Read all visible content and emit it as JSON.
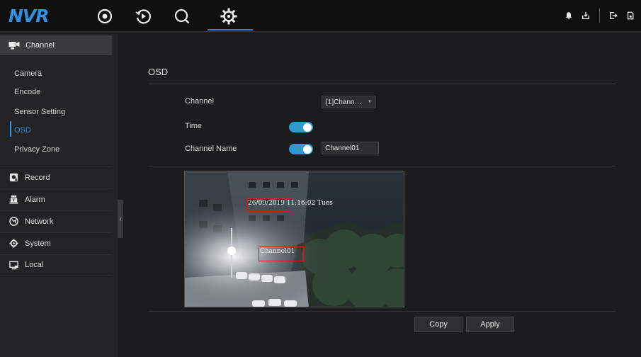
{
  "app": {
    "logo": "NVR"
  },
  "topnav": {
    "icons": [
      "live-view-icon",
      "playback-icon",
      "search-icon",
      "settings-icon"
    ],
    "active": "settings-icon",
    "accent": "#2f8fe0"
  },
  "topright": {
    "icons": [
      "alarm-bell-icon",
      "download-icon",
      "logout-icon",
      "lock-screen-icon"
    ]
  },
  "sidebar": {
    "section": "Channel",
    "subitems": [
      "Camera",
      "Encode",
      "Sensor Setting",
      "OSD",
      "Privacy Zone"
    ],
    "active_subitem": "OSD",
    "menu": [
      "Record",
      "Alarm",
      "Network",
      "System",
      "Local"
    ]
  },
  "main": {
    "title": "OSD",
    "channel_label": "Channel",
    "channel_value": "[1]Chann…",
    "time_label": "Time",
    "time_enabled": true,
    "channel_name_label": "Channel Name",
    "channel_name_enabled": true,
    "channel_name_value": "Channel01",
    "osd_time_text": "26/09/2019 11:16:02 Tues",
    "osd_name_text": "Channel01",
    "copy_label": "Copy",
    "apply_label": "Apply"
  }
}
